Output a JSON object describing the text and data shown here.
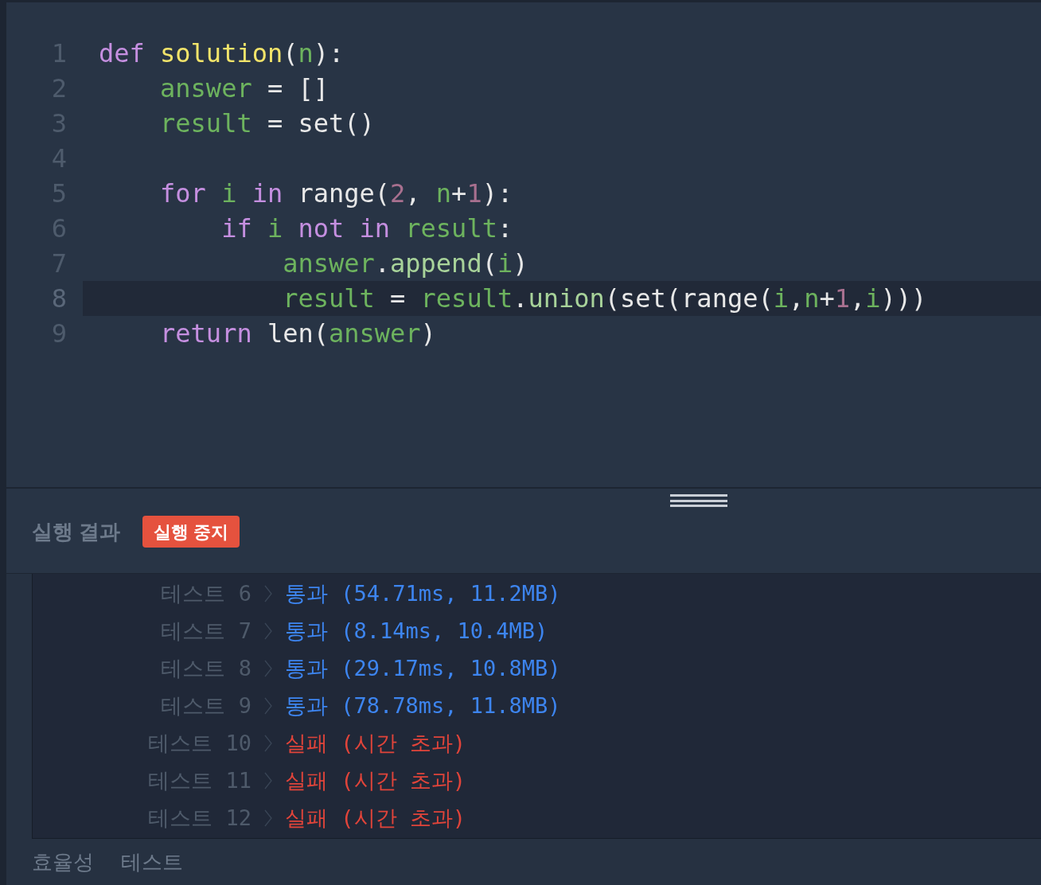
{
  "editor": {
    "lines": [
      {
        "number": "1",
        "current": false,
        "tokens": [
          {
            "kind": "keyword",
            "t": "def"
          },
          {
            "kind": "function",
            "t": " solution"
          },
          {
            "kind": "plain",
            "t": "("
          },
          {
            "kind": "variable",
            "t": "n"
          },
          {
            "kind": "plain",
            "t": "):"
          }
        ]
      },
      {
        "number": "2",
        "current": false,
        "tokens": [
          {
            "kind": "variable",
            "t": "    answer"
          },
          {
            "kind": "plain",
            "t": " = []"
          }
        ]
      },
      {
        "number": "3",
        "current": false,
        "tokens": [
          {
            "kind": "variable",
            "t": "    result"
          },
          {
            "kind": "plain",
            "t": " = set()"
          }
        ]
      },
      {
        "number": "4",
        "current": false
      },
      {
        "number": "5",
        "current": false,
        "tokens": [
          {
            "kind": "keyword",
            "t": "    for"
          },
          {
            "kind": "variable",
            "t": " i"
          },
          {
            "kind": "keyword",
            "t": " in"
          },
          {
            "kind": "plain",
            "t": " range("
          },
          {
            "kind": "number",
            "t": "2"
          },
          {
            "kind": "plain",
            "t": ","
          },
          {
            "kind": "variable",
            "t": " n"
          },
          {
            "kind": "plain",
            "t": "+"
          },
          {
            "kind": "number",
            "t": "1"
          },
          {
            "kind": "plain",
            "t": "):"
          }
        ]
      },
      {
        "number": "6",
        "current": false,
        "tokens": [
          {
            "kind": "keyword",
            "t": "        if"
          },
          {
            "kind": "variable",
            "t": " i"
          },
          {
            "kind": "keyword",
            "t": " not in"
          },
          {
            "kind": "variable",
            "t": " result"
          },
          {
            "kind": "plain",
            "t": ":"
          }
        ]
      },
      {
        "number": "7",
        "current": false,
        "tokens": [
          {
            "kind": "variable",
            "t": "            answer"
          },
          {
            "kind": "plain",
            "t": "."
          },
          {
            "kind": "method",
            "t": "append"
          },
          {
            "kind": "plain",
            "t": "("
          },
          {
            "kind": "variable",
            "t": "i"
          },
          {
            "kind": "plain",
            "t": ")"
          }
        ]
      },
      {
        "number": "8",
        "current": true,
        "tokens": [
          {
            "kind": "variable",
            "t": "            result"
          },
          {
            "kind": "plain",
            "t": " ="
          },
          {
            "kind": "variable",
            "t": " result"
          },
          {
            "kind": "plain",
            "t": "."
          },
          {
            "kind": "method",
            "t": "union"
          },
          {
            "kind": "plain",
            "t": "(set(range("
          },
          {
            "kind": "variable",
            "t": "i"
          },
          {
            "kind": "plain",
            "t": ","
          },
          {
            "kind": "variable",
            "t": "n"
          },
          {
            "kind": "plain",
            "t": "+"
          },
          {
            "kind": "number",
            "t": "1"
          },
          {
            "kind": "plain",
            "t": ","
          },
          {
            "kind": "variable",
            "t": "i"
          },
          {
            "kind": "plain",
            "t": ")))"
          }
        ]
      },
      {
        "number": "9",
        "current": false,
        "tokens": [
          {
            "kind": "keyword",
            "t": "    return"
          },
          {
            "kind": "plain",
            "t": " len("
          },
          {
            "kind": "variable",
            "t": "answer"
          },
          {
            "kind": "plain",
            "t": ")"
          }
        ]
      }
    ]
  },
  "results_panel": {
    "title": "실행 결과",
    "stop_button": "실행 중지",
    "results": [
      {
        "label": "테스트",
        "number": "6",
        "kind": "pass",
        "verdict": "통과",
        "detail": "(54.71ms, 11.2MB)"
      },
      {
        "label": "테스트",
        "number": "7",
        "kind": "pass",
        "verdict": "통과",
        "detail": "(8.14ms, 10.4MB)"
      },
      {
        "label": "테스트",
        "number": "8",
        "kind": "pass",
        "verdict": "통과",
        "detail": "(29.17ms, 10.8MB)"
      },
      {
        "label": "테스트",
        "number": "9",
        "kind": "pass",
        "verdict": "통과",
        "detail": "(78.78ms, 11.8MB)"
      },
      {
        "label": "테스트",
        "number": "10",
        "kind": "fail",
        "verdict": "실패",
        "detail": "(시간 초과)"
      },
      {
        "label": "테스트",
        "number": "11",
        "kind": "fail",
        "verdict": "실패",
        "detail": "(시간 초과)"
      },
      {
        "label": "테스트",
        "number": "12",
        "kind": "fail",
        "verdict": "실패",
        "detail": "(시간 초과)"
      }
    ],
    "section_heading": {
      "first": "효율성",
      "second": "테스트"
    }
  }
}
